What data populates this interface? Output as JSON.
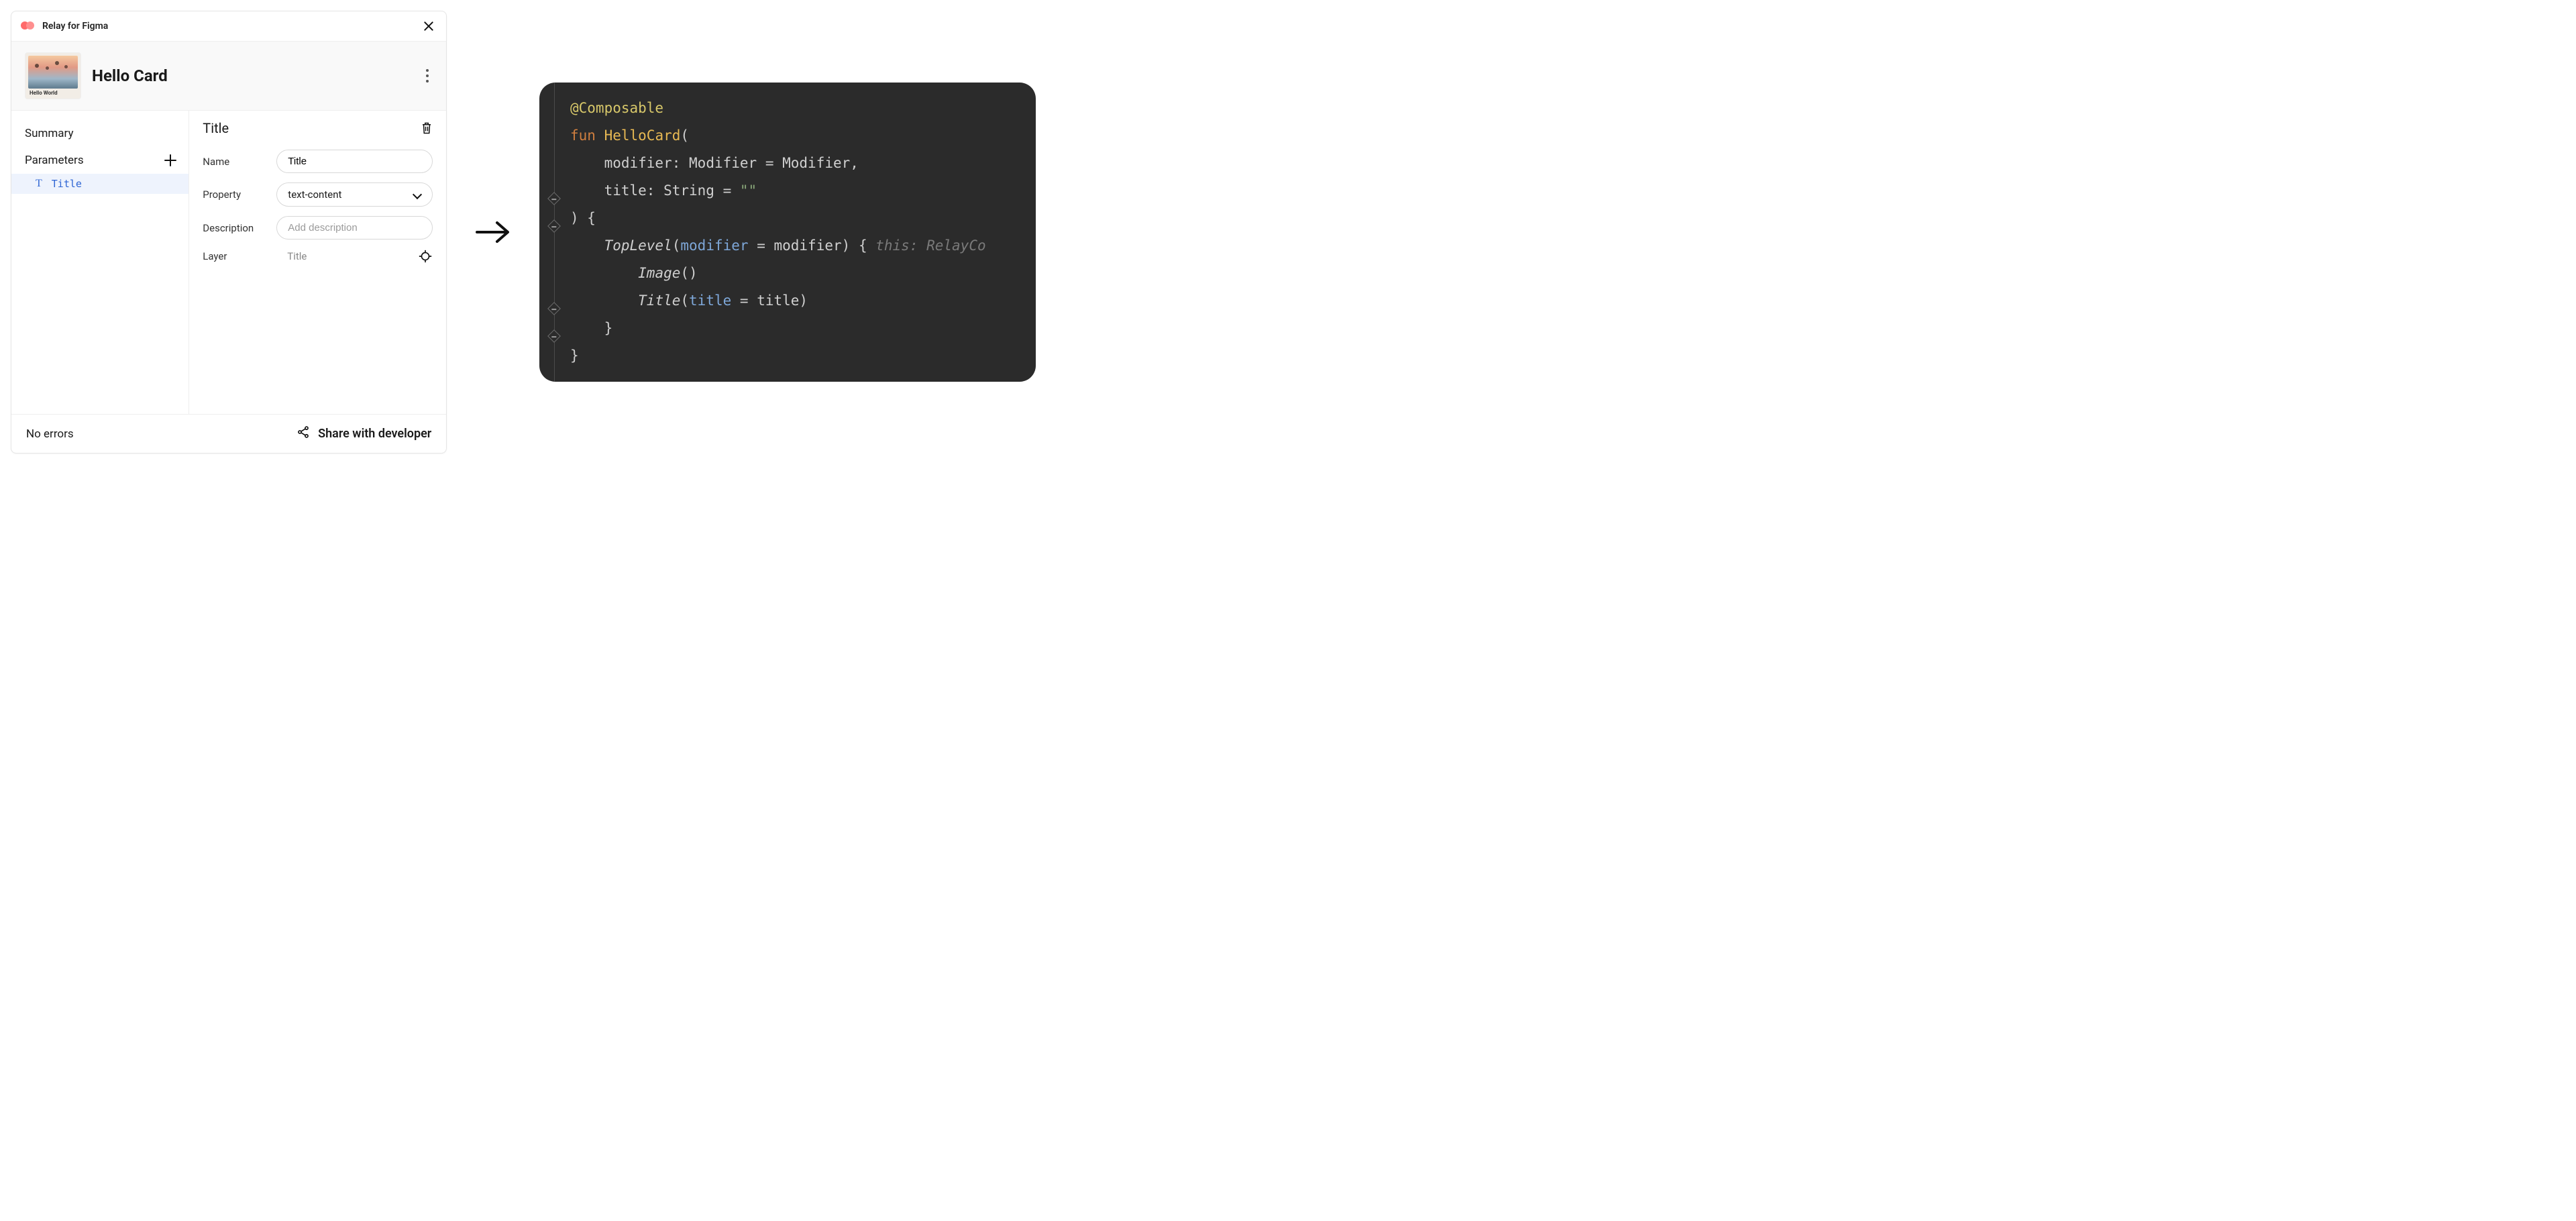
{
  "plugin": {
    "name": "Relay for Figma",
    "card_title": "Hello Card",
    "thumb_caption": "Hello World"
  },
  "sidebar": {
    "summary_label": "Summary",
    "parameters_label": "Parameters",
    "items": [
      {
        "icon": "T",
        "name": "Title"
      }
    ]
  },
  "detail": {
    "title": "Title",
    "fields": {
      "name_label": "Name",
      "name_value": "Title",
      "property_label": "Property",
      "property_value": "text-content",
      "description_label": "Description",
      "description_placeholder": "Add description",
      "layer_label": "Layer",
      "layer_value": "Title"
    }
  },
  "footer": {
    "status": "No errors",
    "share_label": "Share with developer"
  },
  "code": {
    "annotation": "@Composable",
    "fun_keyword": "fun",
    "fun_name": "HelloCard",
    "param1_name": "modifier",
    "param1_type": "Modifier",
    "param1_default": "Modifier",
    "param2_name": "title",
    "param2_type": "String",
    "param2_default": "\"\"",
    "toplevel_call": "TopLevel",
    "toplevel_arg_name": "modifier",
    "toplevel_arg_val": "modifier",
    "inline_hint": "this: RelayCo",
    "image_call": "Image",
    "title_call": "Title",
    "title_arg_name": "title",
    "title_arg_val": "title"
  }
}
